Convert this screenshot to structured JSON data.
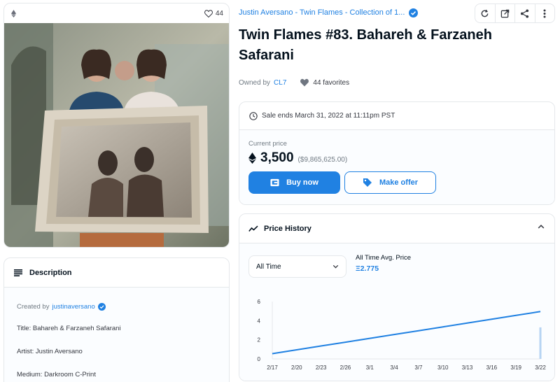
{
  "media": {
    "favorites_count": "44"
  },
  "description": {
    "heading": "Description",
    "created_prefix": "Created by",
    "creator": "justinaversano",
    "lines": [
      "Title: Bahareh & Farzaneh Safarani",
      "Artist: Justin Aversano",
      "Medium: Darkroom C-Print"
    ]
  },
  "item": {
    "collection": "Justin Aversano - Twin Flames - Collection of 1...",
    "title": "Twin Flames #83. Bahareh & Farzaneh Safarani",
    "owned_prefix": "Owned by",
    "owner": "CL7",
    "favorites": "44 favorites"
  },
  "sale": {
    "ends": "Sale ends March 31, 2022 at 11:11pm PST",
    "current_label": "Current price",
    "price": "3,500",
    "usd": "($9,865,625.00)",
    "buy_label": "Buy now",
    "offer_label": "Make offer"
  },
  "history": {
    "heading": "Price History",
    "range": "All Time",
    "avg_label": "All Time Avg. Price",
    "avg_value": "Ξ2.775"
  },
  "colors": {
    "accent": "#2081e2",
    "text": "#04111d",
    "muted": "#707a83",
    "border": "#e5e8eb"
  },
  "chart_data": {
    "type": "line",
    "x": [
      "2/17",
      "2/20",
      "2/23",
      "2/26",
      "3/1",
      "3/4",
      "3/7",
      "3/10",
      "3/13",
      "3/16",
      "3/19",
      "3/22"
    ],
    "series": [
      {
        "values": [
          0.55,
          0.95,
          1.35,
          1.75,
          2.15,
          2.55,
          2.95,
          3.35,
          3.75,
          4.15,
          4.55,
          4.95
        ]
      }
    ],
    "volume_bar": {
      "x": "3/22",
      "value": 3.3
    },
    "yticks": [
      0,
      2,
      4,
      6
    ],
    "ylim": [
      0,
      6
    ],
    "grid": false
  }
}
